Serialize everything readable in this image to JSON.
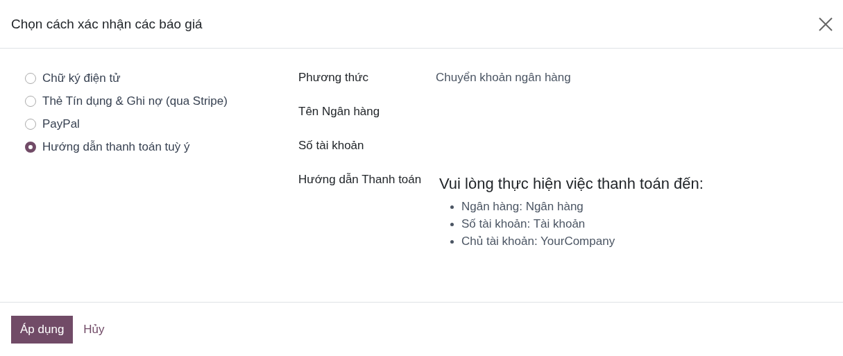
{
  "dialog": {
    "title": "Chọn cách xác nhận các báo giá"
  },
  "options": [
    {
      "label": "Chữ ký điện tử",
      "selected": false
    },
    {
      "label": "Thẻ Tín dụng & Ghi nợ (qua Stripe)",
      "selected": false
    },
    {
      "label": "PayPal",
      "selected": false
    },
    {
      "label": "Hướng dẫn thanh toán tuỳ ý",
      "selected": true
    }
  ],
  "fields": [
    {
      "kind": "text",
      "label": "Phương thức",
      "value": "Chuyển khoản ngân hàng"
    },
    {
      "kind": "text",
      "label": "Tên Ngân hàng"
    },
    {
      "kind": "text",
      "label": "Số tài khoản"
    },
    {
      "kind": "rich",
      "label": "Hướng dẫn Thanh toán",
      "heading": "Vui lòng thực hiện việc thanh toán đến:",
      "bullets": [
        "Ngân hàng: Ngân hàng",
        "Số tài khoản: Tài khoản",
        "Chủ tài khoản: YourCompany"
      ]
    }
  ],
  "buttons": [
    {
      "kind": "primary",
      "label": "Áp dụng"
    },
    {
      "kind": "link",
      "label": "Hủy"
    }
  ]
}
